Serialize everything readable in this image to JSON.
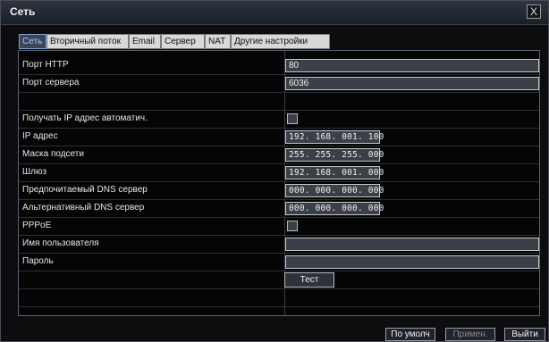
{
  "window": {
    "title": "Сеть",
    "close_glyph": "X"
  },
  "tabs": [
    {
      "label": "Сеть",
      "active": true
    },
    {
      "label": "Вторичный поток"
    },
    {
      "label": "Email"
    },
    {
      "label": "Сервер"
    },
    {
      "label": "NAT"
    },
    {
      "label": "Другие настройки"
    }
  ],
  "fields": {
    "http_port": {
      "label": "Порт HTTP",
      "value": "80"
    },
    "server_port": {
      "label": "Порт сервера",
      "value": "6036"
    },
    "auto_ip": {
      "label": "Получать IP адрес автоматич.",
      "checked": false
    },
    "ip_address": {
      "label": "IP адрес",
      "value": "192. 168. 001. 100"
    },
    "subnet_mask": {
      "label": "Маска подсети",
      "value": "255. 255. 255. 000"
    },
    "gateway": {
      "label": "Шлюз",
      "value": "192. 168. 001. 000"
    },
    "preferred_dns": {
      "label": "Предпочитаемый DNS сервер",
      "value": "000. 000. 000. 000"
    },
    "alternate_dns": {
      "label": "Альтернативный DNS сервер",
      "value": "000. 000. 000. 000"
    },
    "pppoe": {
      "label": "PPPoE",
      "checked": false
    },
    "username": {
      "label": "Имя пользователя",
      "value": ""
    },
    "password": {
      "label": "Пароль",
      "value": ""
    }
  },
  "test_button": "Тест",
  "buttons": {
    "default": "По умолч",
    "apply": "Примен.",
    "exit": "Выйти"
  },
  "colors": {
    "active_tab_text": "#9fd0ff",
    "field_bg": "#3a3f48"
  }
}
